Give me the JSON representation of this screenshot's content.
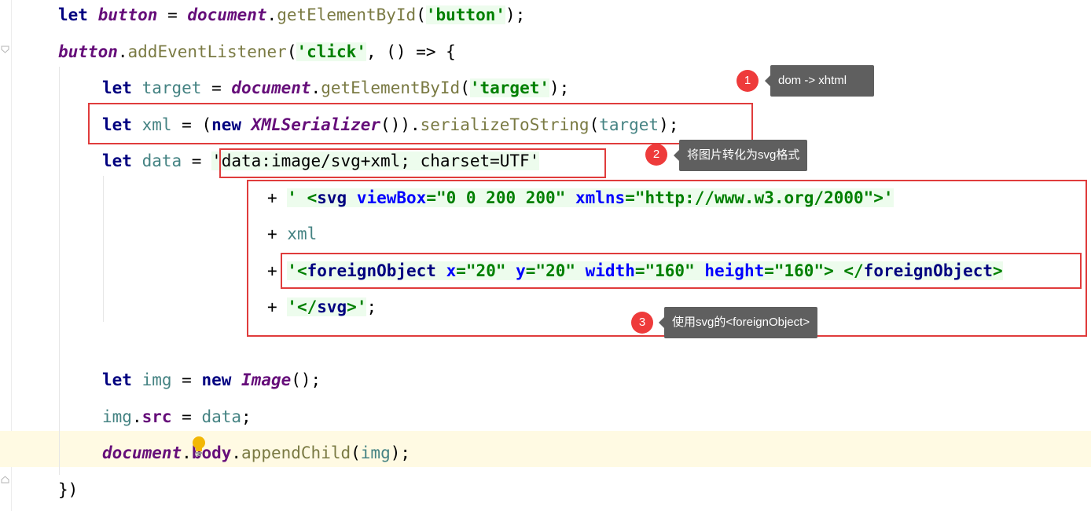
{
  "editor": {
    "lines": [
      [
        {
          "t": "let ",
          "c": "kw"
        },
        {
          "t": "button",
          "c": "gv"
        },
        {
          "t": " = ",
          "c": "plain"
        },
        {
          "t": "document",
          "c": "gv"
        },
        {
          "t": ".",
          "c": "plain"
        },
        {
          "t": "getElementById",
          "c": "fn"
        },
        {
          "t": "(",
          "c": "plain"
        },
        {
          "t": "'button'",
          "c": "str"
        },
        {
          "t": ");",
          "c": "plain"
        }
      ],
      [
        {
          "t": "button",
          "c": "gv"
        },
        {
          "t": ".",
          "c": "plain"
        },
        {
          "t": "addEventListener",
          "c": "fn"
        },
        {
          "t": "(",
          "c": "plain"
        },
        {
          "t": "'click'",
          "c": "str"
        },
        {
          "t": ", () => {",
          "c": "plain"
        }
      ],
      [
        {
          "t": "let ",
          "c": "kw"
        },
        {
          "t": "target",
          "c": "lv"
        },
        {
          "t": " = ",
          "c": "plain"
        },
        {
          "t": "document",
          "c": "gv"
        },
        {
          "t": ".",
          "c": "plain"
        },
        {
          "t": "getElementById",
          "c": "fn"
        },
        {
          "t": "(",
          "c": "plain"
        },
        {
          "t": "'target'",
          "c": "str"
        },
        {
          "t": ");",
          "c": "plain"
        }
      ],
      [
        {
          "t": "let ",
          "c": "kw"
        },
        {
          "t": "xml",
          "c": "lv"
        },
        {
          "t": " = (",
          "c": "plain"
        },
        {
          "t": "new ",
          "c": "kw"
        },
        {
          "t": "XMLSerializer",
          "c": "cls"
        },
        {
          "t": "()).",
          "c": "plain"
        },
        {
          "t": "serializeToString",
          "c": "fn"
        },
        {
          "t": "(",
          "c": "plain"
        },
        {
          "t": "target",
          "c": "lv"
        },
        {
          "t": ");",
          "c": "plain"
        }
      ],
      [
        {
          "t": "let ",
          "c": "kw"
        },
        {
          "t": "data",
          "c": "lv"
        },
        {
          "t": " = ",
          "c": "plain"
        },
        {
          "t": "'data:image/svg+xml; charset=UTF'",
          "c": "str-plain"
        }
      ],
      [
        {
          "t": "+ ",
          "c": "plain"
        },
        {
          "t": "' <",
          "c": "str"
        },
        {
          "t": "svg ",
          "c": "tag"
        },
        {
          "t": "viewBox",
          "c": "attr"
        },
        {
          "t": "=\"0 0 200 200\" ",
          "c": "str"
        },
        {
          "t": "xmlns",
          "c": "attr"
        },
        {
          "t": "=\"http://www.w3.org/2000\">'",
          "c": "str"
        }
      ],
      [
        {
          "t": "+ ",
          "c": "plain"
        },
        {
          "t": "xml",
          "c": "lv"
        }
      ],
      [
        {
          "t": "+ ",
          "c": "plain"
        },
        {
          "t": "'<",
          "c": "str"
        },
        {
          "t": "foreignObject ",
          "c": "tag"
        },
        {
          "t": "x",
          "c": "attr"
        },
        {
          "t": "=\"20\" ",
          "c": "str"
        },
        {
          "t": "y",
          "c": "attr"
        },
        {
          "t": "=\"20\" ",
          "c": "str"
        },
        {
          "t": "width",
          "c": "attr"
        },
        {
          "t": "=\"160\" ",
          "c": "str"
        },
        {
          "t": "height",
          "c": "attr"
        },
        {
          "t": "=\"160\"> </",
          "c": "str"
        },
        {
          "t": "foreignObject",
          "c": "tag"
        },
        {
          "t": ">",
          "c": "str"
        }
      ],
      [
        {
          "t": "+ ",
          "c": "plain"
        },
        {
          "t": "'</",
          "c": "str"
        },
        {
          "t": "svg",
          "c": "tag"
        },
        {
          "t": ">'",
          "c": "str"
        },
        {
          "t": ";",
          "c": "plain"
        }
      ],
      [],
      [
        {
          "t": "let ",
          "c": "kw"
        },
        {
          "t": "img",
          "c": "lv"
        },
        {
          "t": " = ",
          "c": "plain"
        },
        {
          "t": "new ",
          "c": "kw"
        },
        {
          "t": "Image",
          "c": "cls"
        },
        {
          "t": "();",
          "c": "plain"
        }
      ],
      [
        {
          "t": "img",
          "c": "lv"
        },
        {
          "t": ".",
          "c": "plain"
        },
        {
          "t": "src",
          "c": "prop"
        },
        {
          "t": " = ",
          "c": "plain"
        },
        {
          "t": "data",
          "c": "lv"
        },
        {
          "t": ";",
          "c": "plain"
        }
      ],
      [
        {
          "t": "document",
          "c": "gv"
        },
        {
          "t": ".",
          "c": "plain"
        },
        {
          "t": "body",
          "c": "prop"
        },
        {
          "t": ".",
          "c": "plain"
        },
        {
          "t": "appendChild",
          "c": "fn"
        },
        {
          "t": "(",
          "c": "plain"
        },
        {
          "t": "img",
          "c": "lv"
        },
        {
          "t": ");",
          "c": "plain"
        }
      ],
      [
        {
          "t": "})",
          "c": "plain"
        }
      ]
    ]
  },
  "annotations": [
    {
      "number": "1",
      "text": "dom -> xhtml"
    },
    {
      "number": "2",
      "text": "将图片转化为svg格式"
    },
    {
      "number": "3",
      "text": "使用svg的<foreignObject>"
    }
  ],
  "colors": {
    "keyword": "#000080",
    "global": "#660e7a",
    "function": "#7a7a43",
    "local": "#458383",
    "string": "#008000",
    "annotation_box": "#e03c3c",
    "marker": "#ee3b3b",
    "tooltip": "#5f5f5f",
    "caret_line": "#fffae3"
  },
  "icons": {
    "intention": "lightbulb-icon",
    "fold": "fold-marker-icon"
  }
}
